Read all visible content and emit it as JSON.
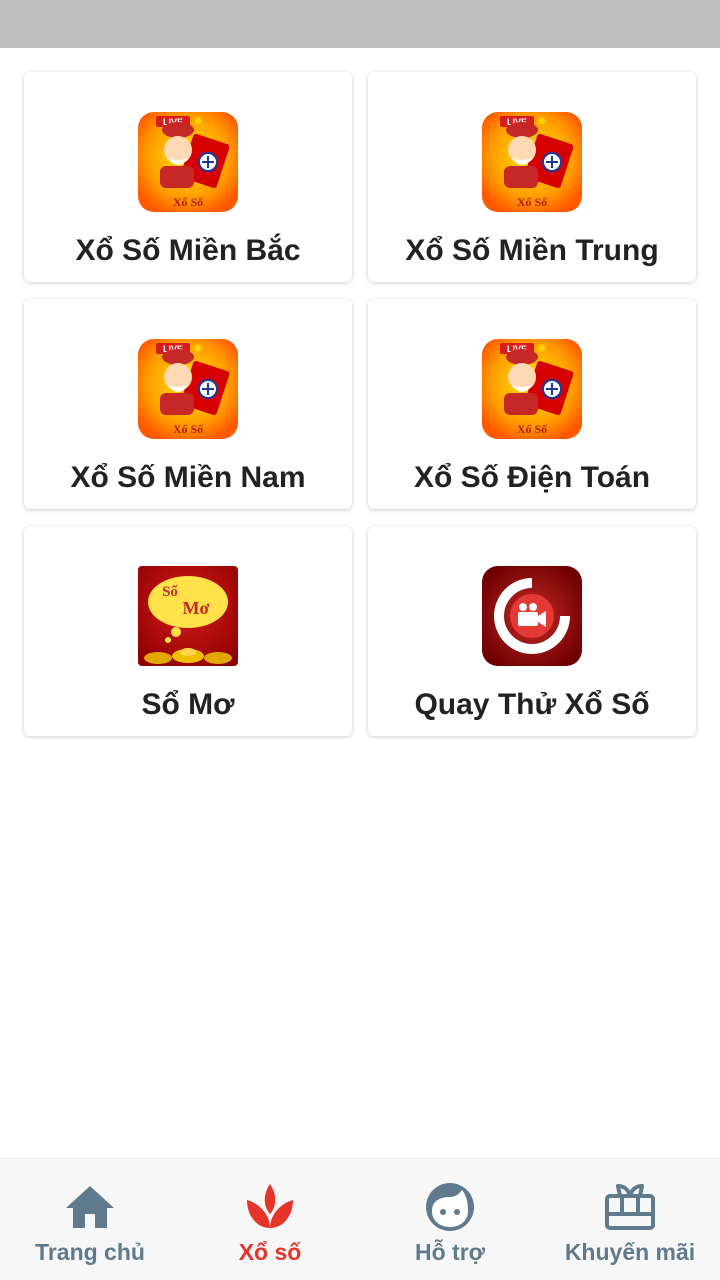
{
  "cards": [
    {
      "label": "Xổ Số Miền Bắc",
      "icon": "xo-so-live-icon",
      "icon_text_top": "LIVE",
      "icon_text_bottom": "Xổ Số"
    },
    {
      "label": "Xổ Số Miền Trung",
      "icon": "xo-so-live-icon",
      "icon_text_top": "LIVE",
      "icon_text_bottom": "Xổ Số"
    },
    {
      "label": "Xổ Số Miền Nam",
      "icon": "xo-so-live-icon",
      "icon_text_top": "LIVE",
      "icon_text_bottom": "Xổ Số"
    },
    {
      "label": "Xổ Số Điện Toán",
      "icon": "xo-so-live-icon",
      "icon_text_top": "LIVE",
      "icon_text_bottom": "Xổ Số"
    },
    {
      "label": "Sổ Mơ",
      "icon": "so-mo-icon",
      "icon_text_top": "Sổ",
      "icon_text_bottom": "Mơ"
    },
    {
      "label": "Quay Thử Xổ Số",
      "icon": "video-camera-icon"
    }
  ],
  "bottom_nav": [
    {
      "label": "Trang chủ",
      "icon": "home-icon",
      "active": false
    },
    {
      "label": "Xổ số",
      "icon": "lotus-icon",
      "active": true
    },
    {
      "label": "Hỗ trợ",
      "icon": "face-icon",
      "active": false
    },
    {
      "label": "Khuyến mãi",
      "icon": "gift-icon",
      "active": false
    }
  ],
  "colors": {
    "accent_active": "#e5352b",
    "nav_inactive": "#5f7a8c",
    "status_bar": "#bdbdbd"
  }
}
